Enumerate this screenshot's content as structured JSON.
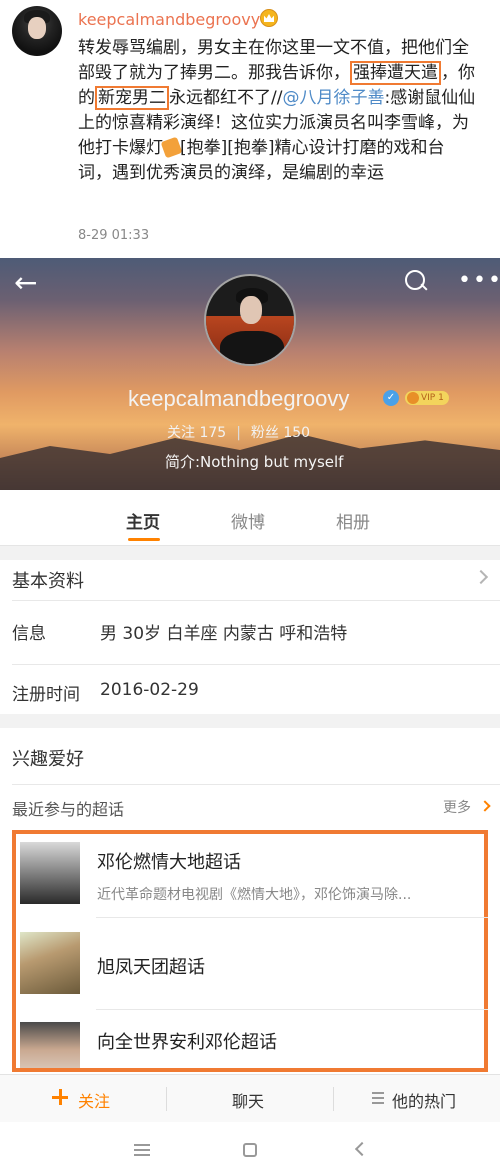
{
  "post": {
    "username": "keepcalmandbegroovy",
    "text_1": "转发辱骂编剧，男女主在你这里一文不值，把他们全部毁了就为了捧男二。那我告诉你，",
    "hl_1": "强捧遭天遣",
    "text_2": "，你的",
    "hl_2": "新宠男二",
    "text_3": "永远都红不了//",
    "mention": "@八月徐子善",
    "text_4": ":感谢鼠仙仙上的惊喜精彩演绎！这位实力派演员名叫李雪峰，为他打卡爆灯",
    "text_5": "[抱拳][抱拳]精心设计打磨的戏和台词，遇到优秀演员的演绎，是编剧的幸运",
    "time": "8-29 01:33"
  },
  "profile": {
    "name": "keepcalmandbegroovy",
    "v_badge": "✓",
    "vip_label": "VIP 1",
    "following_label": "关注",
    "following_count": "175",
    "followers_label": "粉丝",
    "followers_count": "150",
    "bio": "简介:Nothing  but myself"
  },
  "tabs": [
    {
      "label": "主页"
    },
    {
      "label": "微博"
    },
    {
      "label": "相册"
    }
  ],
  "basic_info": {
    "title": "基本资料",
    "info_label": "信息",
    "info_value": "男  30岁  白羊座  内蒙古 呼和浩特",
    "register_label": "注册时间",
    "register_value": "2016-02-29"
  },
  "interests": {
    "title": "兴趣爱好",
    "recent_label": "最近参与的超话",
    "more_label": "更多"
  },
  "topics": [
    {
      "title": "邓伦燃情大地超话",
      "desc": "近代革命题材电视剧《燃情大地》，邓伦饰演马除..."
    },
    {
      "title": "旭凤天团超话",
      "desc": ""
    },
    {
      "title": "向全世界安利邓伦超话",
      "desc": ""
    }
  ],
  "actions": {
    "follow": "关注",
    "chat": "聊天",
    "hot": "他的热门"
  },
  "colors": {
    "accent": "#ff8200",
    "highlight_box": "#f07a32",
    "link": "#4e8ac7",
    "username": "#eb7350"
  }
}
